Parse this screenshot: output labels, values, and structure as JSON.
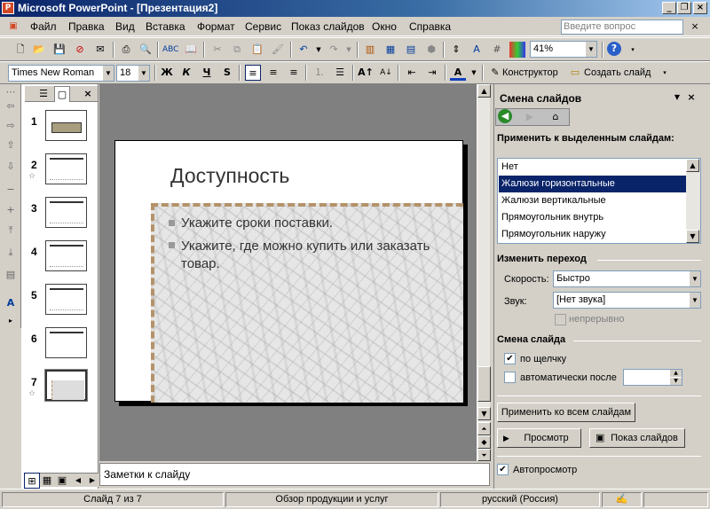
{
  "window": {
    "title": "Microsoft PowerPoint - [Презентация2]",
    "app_icon": "P"
  },
  "menu": {
    "items": [
      "Файл",
      "Правка",
      "Вид",
      "Вставка",
      "Формат",
      "Сервис",
      "Показ слайдов",
      "Окно",
      "Справка"
    ],
    "help_placeholder": "Введите вопрос"
  },
  "toolbar": {
    "zoom": "41%"
  },
  "formatting": {
    "font_name": "Times New Roman",
    "font_size": "18",
    "bold": "Ж",
    "italic": "К",
    "underline": "Ч",
    "shadow": "S",
    "designer_label": "Конструктор",
    "new_slide_label": "Создать слайд"
  },
  "thumbnails": {
    "numbers": [
      "1",
      "2",
      "3",
      "4",
      "5",
      "6",
      "7"
    ]
  },
  "slide": {
    "title": "Доступность",
    "bullets": [
      "Укажите сроки поставки.",
      "Укажите, где можно купить или заказать товар."
    ]
  },
  "notes": {
    "placeholder": "Заметки к слайду"
  },
  "taskpane": {
    "title": "Смена слайдов",
    "apply_label": "Применить к выделенным слайдам:",
    "transitions": [
      "Нет",
      "Жалюзи горизонтальные",
      "Жалюзи вертикальные",
      "Прямоугольник внутрь",
      "Прямоугольник наружу"
    ],
    "modify_header": "Изменить переход",
    "speed_label": "Скорость:",
    "speed_value": "Быстро",
    "sound_label": "Звук:",
    "sound_value": "[Нет звука]",
    "loop_label": "непрерывно",
    "advance_header": "Смена слайда",
    "on_click_label": "по щелчку",
    "auto_label": "автоматически после",
    "apply_all_button": "Применить ко всем слайдам",
    "preview_button": "Просмотр",
    "slideshow_button": "Показ слайдов",
    "autopreview_label": "Автопросмотр"
  },
  "statusbar": {
    "slide_info": "Слайд 7 из 7",
    "design": "Обзор продукции и услуг",
    "language": "русский (Россия)"
  }
}
